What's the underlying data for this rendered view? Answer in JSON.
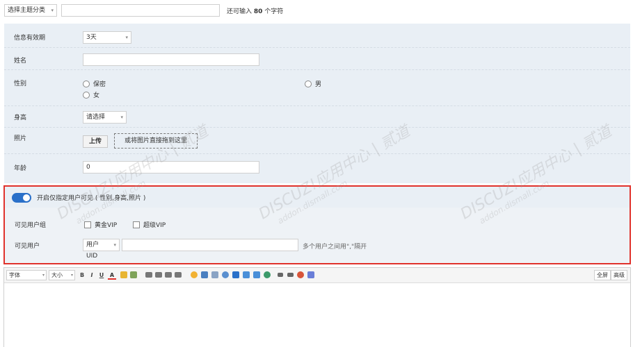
{
  "topic": {
    "category_select": "选择主题分类",
    "title_value": "",
    "char_hint_prefix": "还可输入",
    "char_count": "80",
    "char_hint_suffix": "个字符"
  },
  "form": {
    "validity": {
      "label": "信息有效期",
      "value": "3天"
    },
    "name": {
      "label": "姓名",
      "value": ""
    },
    "gender": {
      "label": "性别",
      "options": [
        "保密",
        "男",
        "女"
      ]
    },
    "height": {
      "label": "身高",
      "value": "请选择"
    },
    "photo": {
      "label": "照片",
      "upload_label": "上传",
      "drop_hint": "或将图片直接拖到这里"
    },
    "age": {
      "label": "年龄",
      "value": "0"
    }
  },
  "visibility": {
    "toggle_label": "开启仅指定用户可见 ( 性别,身高,照片 )",
    "groups_label": "可见用户组",
    "groups": [
      "黄金VIP",
      "超级VIP"
    ],
    "users_label": "可见用户",
    "user_type": "用户UID",
    "users_value": "",
    "users_hint": "多个用户之间用\",\"隔开"
  },
  "editor": {
    "font_select": "字体",
    "size_select": "大小",
    "buttons": [
      "B",
      "I",
      "U",
      "A"
    ],
    "fullscreen_label": "全屏",
    "advanced_label": "高级"
  },
  "watermark": {
    "text": "DISCUZ!应用中心 | 贰道",
    "sub": "addon.dismall.com"
  },
  "colors": {
    "accent": "#2a70c9",
    "highlight_border": "#e0312b",
    "panel_bg": "#e9eff5"
  }
}
